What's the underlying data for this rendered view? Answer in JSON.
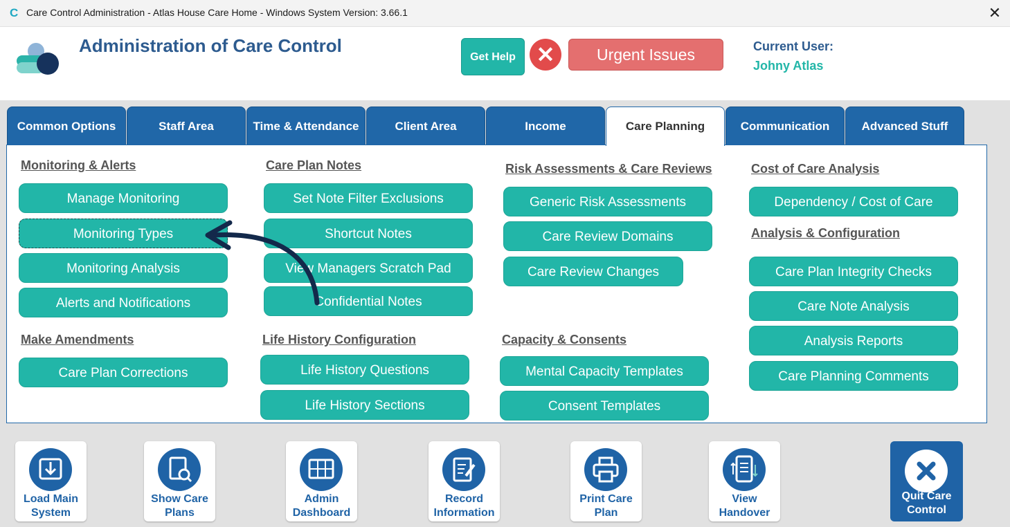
{
  "window": {
    "title": "Care Control Administration - Atlas House Care Home - Windows System Version: 3.66.1",
    "app_icon_glyph": "C",
    "close_glyph": "✕"
  },
  "header": {
    "title": "Administration of Care Control",
    "get_help_label": "Get Help",
    "urgent_glyph": "✕",
    "urgent_label": "Urgent Issues",
    "current_user_label": "Current User:",
    "current_user_name": "Johny Atlas"
  },
  "tabs": [
    {
      "label": "Common Options"
    },
    {
      "label": "Staff Area"
    },
    {
      "label": "Time & Attendance"
    },
    {
      "label": "Client Area"
    },
    {
      "label": "Income"
    },
    {
      "label": "Care Planning",
      "active": true
    },
    {
      "label": "Communication"
    },
    {
      "label": "Advanced Stuff"
    }
  ],
  "panel": {
    "monitoring": {
      "heading": "Monitoring & Alerts",
      "buttons": [
        "Manage Monitoring",
        "Monitoring Types",
        "Monitoring Analysis",
        "Alerts and Notifications"
      ]
    },
    "amendments": {
      "heading": "Make Amendments",
      "buttons": [
        "Care Plan Corrections"
      ]
    },
    "notes": {
      "heading": "Care Plan Notes",
      "buttons": [
        "Set Note Filter Exclusions",
        "Shortcut Notes",
        "View Managers Scratch Pad",
        "Confidential Notes"
      ]
    },
    "life_history": {
      "heading": "Life History Configuration",
      "buttons": [
        "Life History Questions",
        "Life History Sections"
      ]
    },
    "risk": {
      "heading": "Risk Assessments & Care Reviews",
      "buttons": [
        "Generic Risk Assessments",
        "Care Review Domains",
        "Care Review Changes"
      ]
    },
    "capacity": {
      "heading": "Capacity & Consents",
      "buttons": [
        "Mental Capacity Templates",
        "Consent Templates"
      ]
    },
    "cost": {
      "heading": "Cost of Care Analysis",
      "buttons": [
        "Dependency / Cost of Care"
      ]
    },
    "analysis": {
      "heading": "Analysis & Configuration",
      "buttons": [
        "Care Plan Integrity Checks",
        "Care Note Analysis",
        "Analysis Reports",
        "Care Planning Comments"
      ]
    }
  },
  "bottom": {
    "load_main": {
      "line1": "Load Main",
      "line2": "System",
      "icon": "download-tray-icon"
    },
    "show_care": {
      "line1": "Show Care",
      "line2": "Plans",
      "icon": "document-search-icon"
    },
    "admin": {
      "line1": "Admin",
      "line2": "Dashboard",
      "icon": "dashboard-icon"
    },
    "record": {
      "line1": "Record",
      "line2": "Information",
      "icon": "edit-document-icon"
    },
    "print": {
      "line1": "Print Care",
      "line2": "Plan",
      "icon": "printer-icon"
    },
    "handover": {
      "line1": "View",
      "line2": "Handover",
      "icon": "handover-list-icon"
    },
    "quit": {
      "line1": "Quit Care",
      "line2": "Control",
      "icon": "close-icon"
    }
  },
  "colors": {
    "tab_blue": "#2067a8",
    "teal_button": "#22b6a8",
    "title_blue": "#2d5b8f",
    "urgent_red": "#e46f6f"
  }
}
